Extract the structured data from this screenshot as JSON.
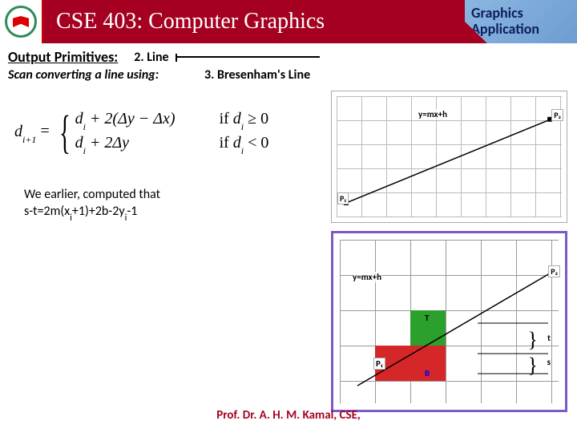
{
  "header": {
    "course_title": "CSE 403: Computer Graphics",
    "tag_line1": "Graphics",
    "tag_line2": "Application"
  },
  "section": {
    "label": "Output Primitives:",
    "subtopic": "2. Line",
    "scan_text": "Scan converting a line using:",
    "method": "3. Bresenham's Line"
  },
  "formula": {
    "lhs_var": "d",
    "lhs_sub": "i+1",
    "equals": " = ",
    "case1_expr": "d_i + 2(Δy − Δx)",
    "case1_cond": "if d_i ≥ 0",
    "case2_expr": "d_i + 2Δy",
    "case2_cond": "if d_i < 0"
  },
  "note": {
    "line1": "We earlier, computed that",
    "line2": "s-t=2m(x_i+1)+2b-2y_i-1"
  },
  "fig_top": {
    "line_eq": "y=mx+h",
    "p1": "P₁",
    "p2": "P₂"
  },
  "fig_bottom": {
    "line_eq": "y=mx+h",
    "p1": "P₁",
    "p2": "P₂",
    "T": "T",
    "B": "B",
    "t": "t",
    "s": "s"
  },
  "footer": {
    "author": "Prof. Dr. A. H. M. Kamal, CSE,"
  }
}
